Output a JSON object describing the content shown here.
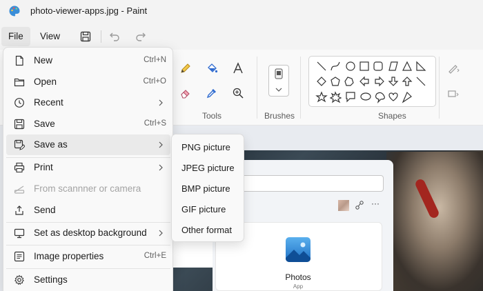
{
  "window": {
    "title": "photo-viewer-apps.jpg - Paint",
    "app_icon": "paint-palette-icon"
  },
  "menubar": {
    "file_label": "File",
    "view_label": "View",
    "quick_actions": [
      "save-icon",
      "undo-icon",
      "redo-icon"
    ]
  },
  "ribbon": {
    "tools_label": "Tools",
    "brushes_label": "Brushes",
    "shapes_label": "Shapes",
    "tools": [
      "pencil-icon",
      "fill-bucket-icon",
      "text-icon",
      "eraser-icon",
      "color-picker-icon",
      "magnifier-icon"
    ]
  },
  "file_menu": {
    "items": [
      {
        "label": "New",
        "shortcut": "Ctrl+N",
        "icon": "new-file-icon"
      },
      {
        "label": "Open",
        "shortcut": "Ctrl+O",
        "icon": "folder-icon"
      },
      {
        "label": "Recent",
        "shortcut": "",
        "icon": "clock-icon",
        "submenu": true
      },
      {
        "label": "Save",
        "shortcut": "Ctrl+S",
        "icon": "save-icon"
      },
      {
        "label": "Save as",
        "shortcut": "",
        "icon": "save-as-icon",
        "submenu": true,
        "active": true
      },
      {
        "label": "Print",
        "shortcut": "",
        "icon": "printer-icon",
        "submenu": true
      },
      {
        "label": "From scannner or camera",
        "shortcut": "",
        "icon": "scanner-icon",
        "disabled": true
      },
      {
        "label": "Send",
        "shortcut": "",
        "icon": "send-icon"
      },
      {
        "label": "Set as desktop background",
        "shortcut": "",
        "icon": "desktop-icon",
        "submenu": true
      },
      {
        "label": "Image properties",
        "shortcut": "Ctrl+E",
        "icon": "image-properties-icon"
      },
      {
        "label": "Settings",
        "shortcut": "",
        "icon": "gear-icon"
      }
    ]
  },
  "save_as_menu": {
    "items": [
      "PNG picture",
      "JPEG picture",
      "BMP picture",
      "GIF picture",
      "Other format"
    ]
  },
  "canvas": {
    "photos_app_name": "Photos",
    "photos_app_sub": "App"
  },
  "colors": {
    "menu_bg": "#f9f9f9",
    "active_item": "#eaeaea",
    "disabled_text": "#a3a3a3",
    "accent": "#1e6fc4"
  }
}
